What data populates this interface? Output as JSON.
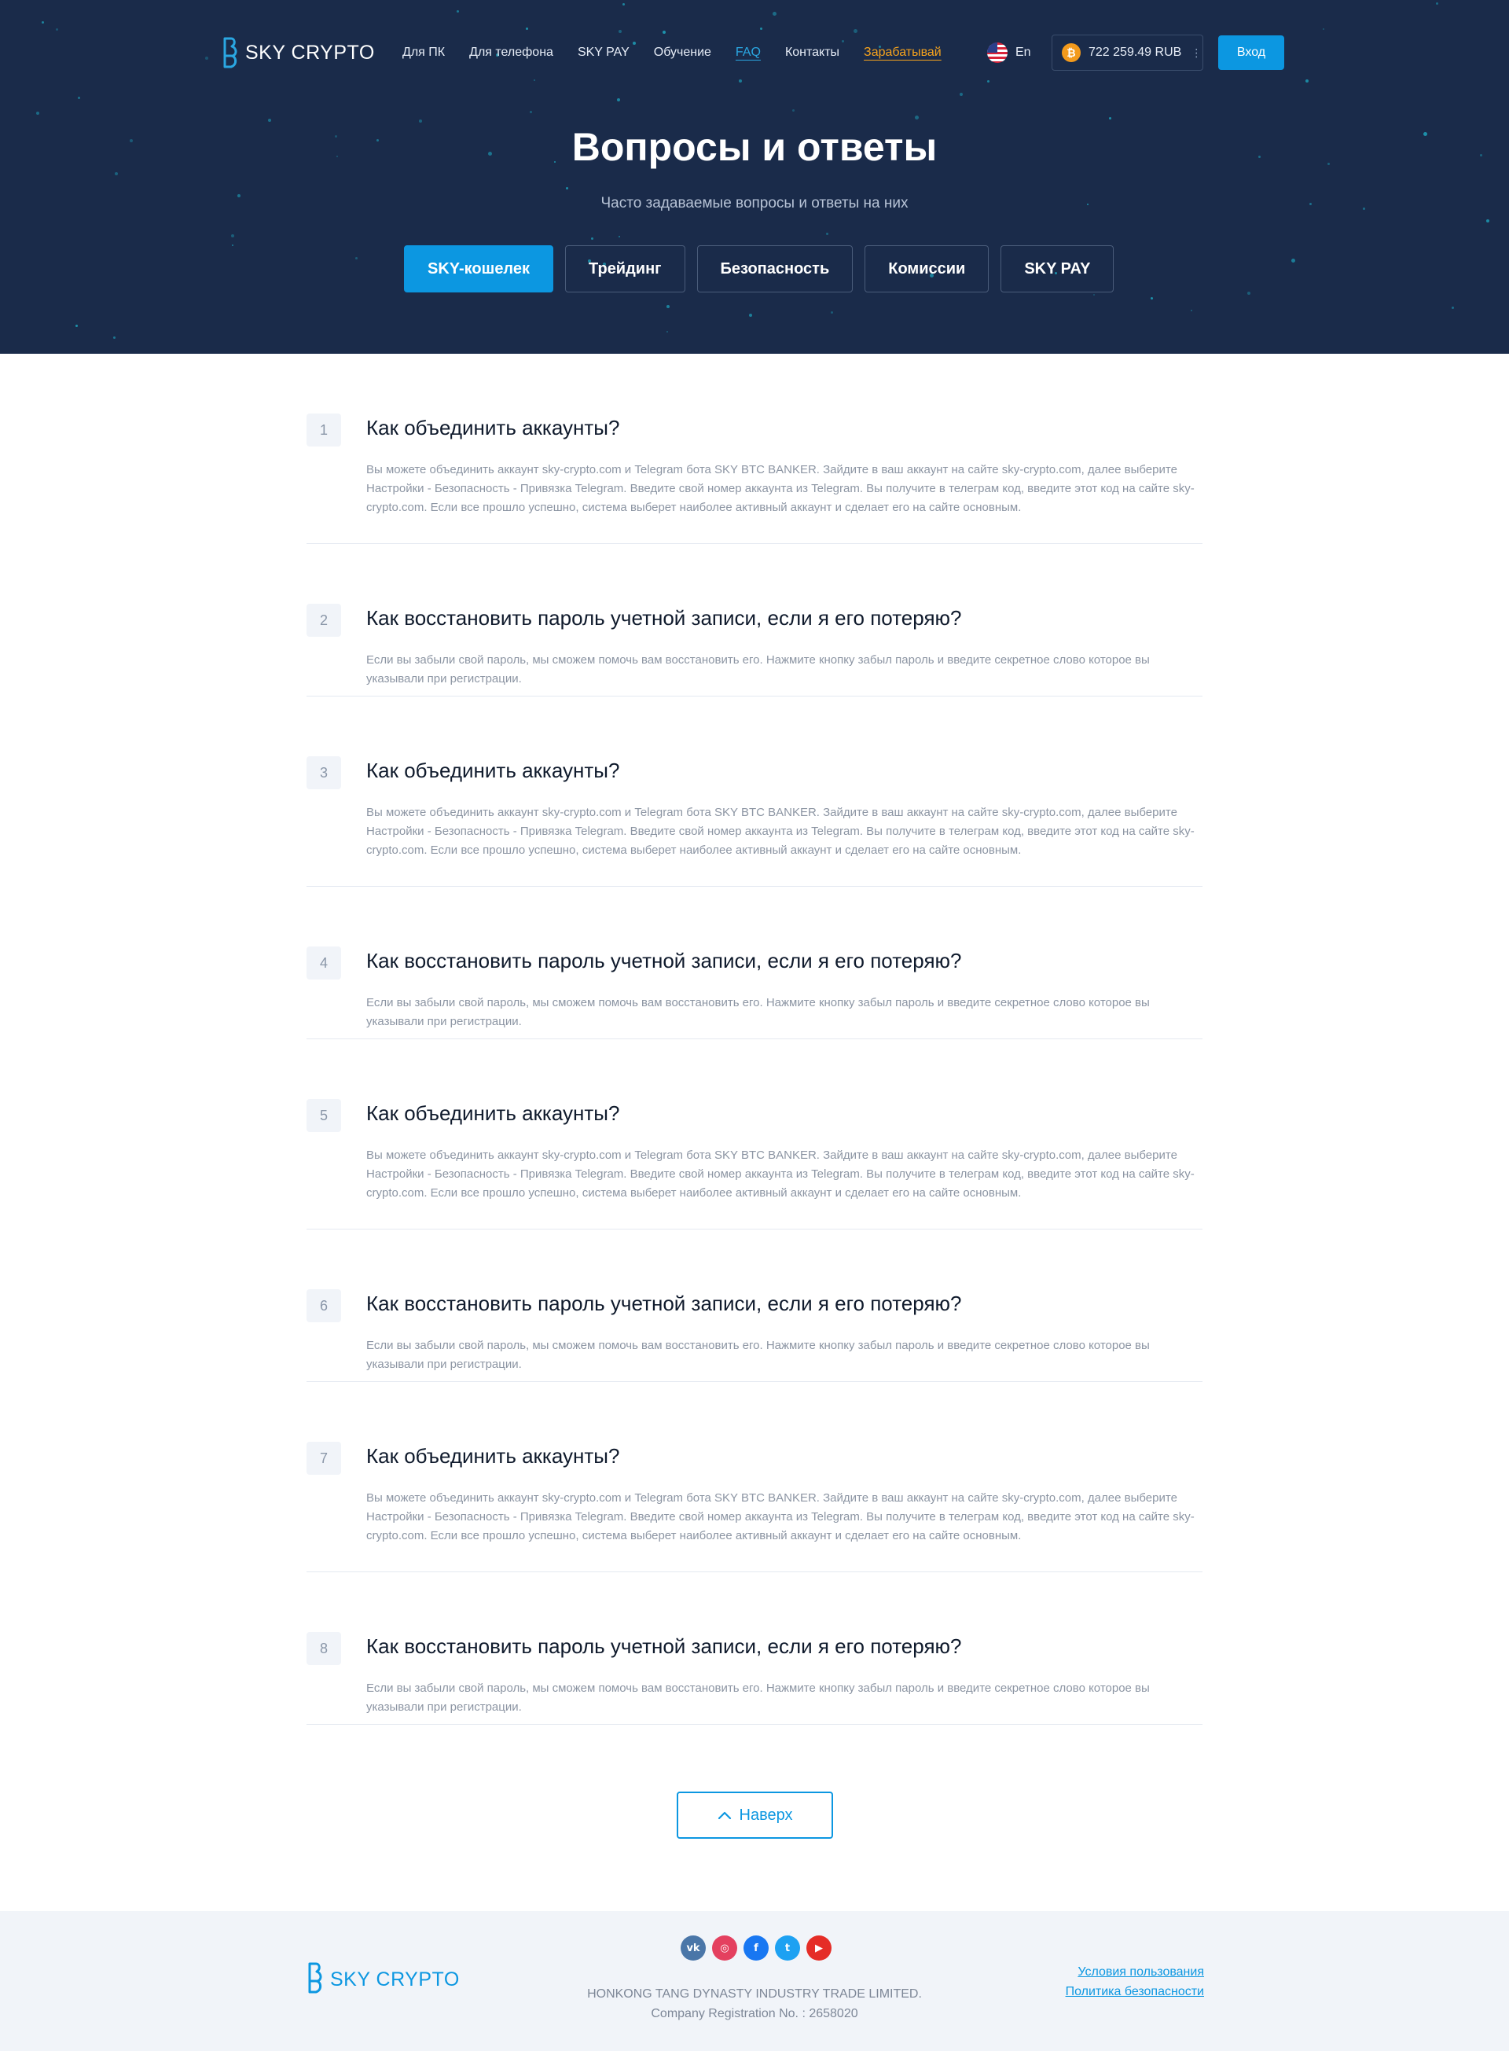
{
  "brand": {
    "logo_text": "SKY CRYPTO"
  },
  "nav": {
    "items": [
      {
        "label": "Для ПК"
      },
      {
        "label": "Для телефона"
      },
      {
        "label": "SKY PAY"
      },
      {
        "label": "Обучение"
      },
      {
        "label": "FAQ",
        "active": true
      },
      {
        "label": "Контакты"
      },
      {
        "label": "Зарабатывай",
        "highlight": "#f6a31d"
      }
    ],
    "language": "En",
    "balance": "722 259.49 RUB",
    "login_label": "Вход"
  },
  "hero": {
    "title": "Вопросы и ответы",
    "subtitle": "Часто задаваемые вопросы и ответы на них",
    "tabs": [
      {
        "label": "SKY-кошелек",
        "active": true
      },
      {
        "label": "Трейдинг"
      },
      {
        "label": "Безопасность"
      },
      {
        "label": "Комиссии"
      },
      {
        "label": "SKY PAY"
      }
    ]
  },
  "faq": [
    {
      "num": "1",
      "question": "Как объединить аккаунты?",
      "answer": "Вы можете объединить аккаунт sky-crypto.com и Telegram бота SKY BTC BANKER. Зайдите в ваш аккаунт на сайте sky-crypto.com, далее выберите Настройки - Безопасность - Привязка Telegram. Введите свой номер аккаунта из Telegram. Вы получите в телеграм код, введите этот код на сайте sky-crypto.com. Если все прошло успешно, система выберет наиболее активный аккаунт и сделает его на сайте основным."
    },
    {
      "num": "2",
      "question": "Как восстановить пароль учетной записи, если я его потеряю?",
      "answer": "Если вы забыли свой пароль, мы сможем помочь вам восстановить его. Нажмите кнопку забыл пароль и введите секретное слово которое вы указывали при регистрации."
    },
    {
      "num": "3",
      "question": "Как объединить аккаунты?",
      "answer": "Вы можете объединить аккаунт sky-crypto.com и Telegram бота SKY BTC BANKER. Зайдите в ваш аккаунт на сайте sky-crypto.com, далее выберите Настройки - Безопасность - Привязка Telegram. Введите свой номер аккаунта из Telegram. Вы получите в телеграм код, введите этот код на сайте sky-crypto.com. Если все прошло успешно, система выберет наиболее активный аккаунт и сделает его на сайте основным."
    },
    {
      "num": "4",
      "question": "Как восстановить пароль учетной записи, если я его потеряю?",
      "answer": "Если вы забыли свой пароль, мы сможем помочь вам восстановить его. Нажмите кнопку забыл пароль и введите секретное слово которое вы указывали при регистрации."
    },
    {
      "num": "5",
      "question": "Как объединить аккаунты?",
      "answer": "Вы можете объединить аккаунт sky-crypto.com и Telegram бота SKY BTC BANKER. Зайдите в ваш аккаунт на сайте sky-crypto.com, далее выберите Настройки - Безопасность - Привязка Telegram. Введите свой номер аккаунта из Telegram. Вы получите в телеграм код, введите этот код на сайте sky-crypto.com. Если все прошло успешно, система выберет наиболее активный аккаунт и сделает его на сайте основным."
    },
    {
      "num": "6",
      "question": "Как восстановить пароль учетной записи, если я его потеряю?",
      "answer": "Если вы забыли свой пароль, мы сможем помочь вам восстановить его. Нажмите кнопку забыл пароль и введите секретное слово которое вы указывали при регистрации."
    },
    {
      "num": "7",
      "question": "Как объединить аккаунты?",
      "answer": "Вы можете объединить аккаунт sky-crypto.com и Telegram бота SKY BTC BANKER. Зайдите в ваш аккаунт на сайте sky-crypto.com, далее выберите Настройки - Безопасность - Привязка Telegram. Введите свой номер аккаунта из Telegram. Вы получите в телеграм код, введите этот код на сайте sky-crypto.com. Если все прошло успешно, система выберет наиболее активный аккаунт и сделает его на сайте основным."
    },
    {
      "num": "8",
      "question": "Как восстановить пароль учетной записи, если я его потеряю?",
      "answer": "Если вы забыли свой пароль, мы сможем помочь вам восстановить его. Нажмите кнопку забыл пароль и введите секретное слово которое вы указывали при регистрации."
    }
  ],
  "back_to_top_label": "Наверх",
  "footer": {
    "logo_text": "SKY CRYPTO",
    "socials": [
      {
        "name": "vk-icon",
        "glyph": "vk",
        "color": "#4a76a8"
      },
      {
        "name": "instagram-icon",
        "glyph": "◎",
        "color": "#e4405f"
      },
      {
        "name": "facebook-icon",
        "glyph": "f",
        "color": "#1877f2"
      },
      {
        "name": "twitter-icon",
        "glyph": "t",
        "color": "#1da1f2"
      },
      {
        "name": "youtube-icon",
        "glyph": "▶",
        "color": "#e52d27"
      }
    ],
    "company_name": "HONKONG TANG DYNASTY INDUSTRY TRADE LIMITED.",
    "registration": "Company Registration No. : 2658020",
    "links": [
      {
        "label": "Условия пользования"
      },
      {
        "label": "Политика безопасности"
      }
    ]
  },
  "colors": {
    "hero_bg": "#1a2b4a",
    "accent": "#0c97e1",
    "earn": "#f6a31d",
    "footer_bg": "#f1f4f9"
  }
}
